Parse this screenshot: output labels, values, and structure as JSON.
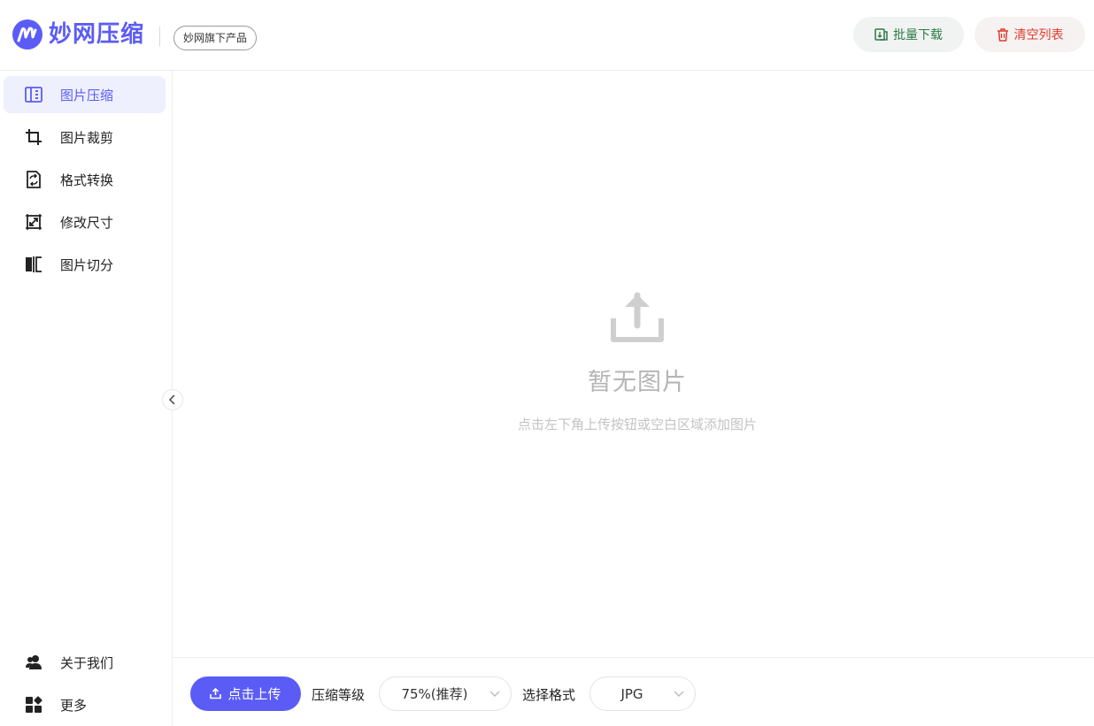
{
  "header": {
    "logo_text": "妙网压缩",
    "product_badge": "妙网旗下产品",
    "download_label": "批量下载",
    "clear_label": "清空列表",
    "download_icon": "download-file-icon",
    "clear_icon": "trash-icon"
  },
  "sidebar": {
    "items": [
      {
        "label": "图片压缩",
        "icon": "image-compress-icon",
        "active": true
      },
      {
        "label": "图片裁剪",
        "icon": "crop-icon",
        "active": false
      },
      {
        "label": "格式转换",
        "icon": "format-convert-icon",
        "active": false
      },
      {
        "label": "修改尺寸",
        "icon": "resize-icon",
        "active": false
      },
      {
        "label": "图片切分",
        "icon": "split-icon",
        "active": false
      }
    ],
    "bottom_items": [
      {
        "label": "关于我们",
        "icon": "users-icon"
      },
      {
        "label": "更多",
        "icon": "apps-icon"
      }
    ]
  },
  "main": {
    "empty_title": "暂无图片",
    "empty_hint": "点击左下角上传按钮或空白区域添加图片"
  },
  "footer": {
    "upload_label": "点击上传",
    "level_label": "压缩等级",
    "level_value": "75%(推荐)",
    "format_label": "选择格式",
    "format_value": "JPG"
  },
  "colors": {
    "accent": "#5b5cf5",
    "download_text": "#2f7a46",
    "clear_text": "#e03b2e"
  }
}
